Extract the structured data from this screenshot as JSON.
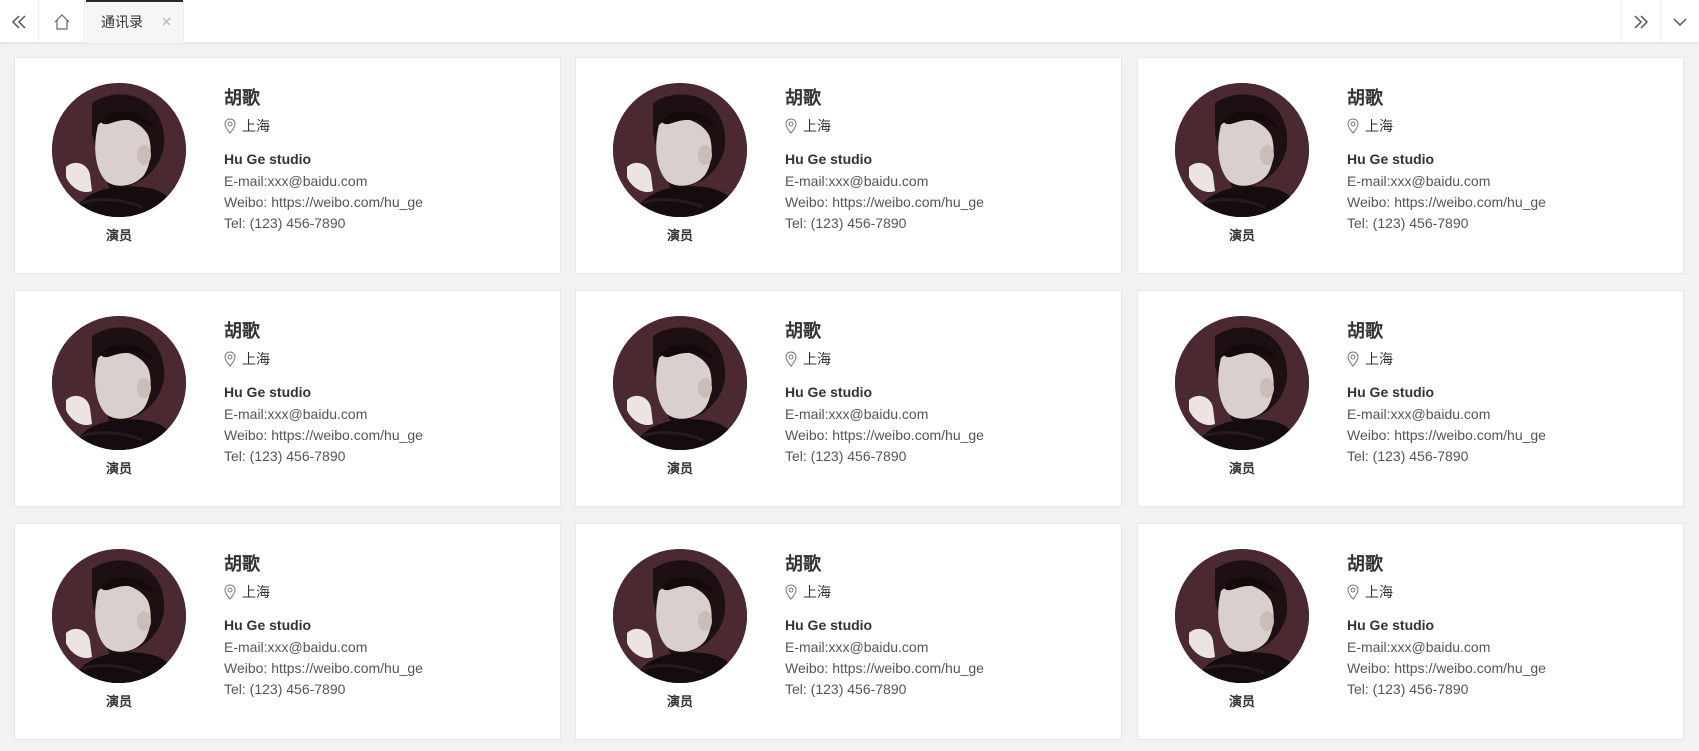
{
  "tabbar": {
    "prev_icon": "double-chevron-left-icon",
    "home_icon": "home-icon",
    "active_tab": {
      "label": "通讯录",
      "close_icon": "close-icon"
    },
    "next_icon": "double-chevron-right-icon",
    "more_icon": "chevron-down-icon"
  },
  "contacts": [
    {
      "name": "胡歌",
      "location": "上海",
      "role": "演员",
      "company": "Hu Ge studio",
      "email": "E-mail:xxx@baidu.com",
      "weibo": "Weibo: https://weibo.com/hu_ge",
      "tel": "Tel: (123) 456-7890"
    },
    {
      "name": "胡歌",
      "location": "上海",
      "role": "演员",
      "company": "Hu Ge studio",
      "email": "E-mail:xxx@baidu.com",
      "weibo": "Weibo: https://weibo.com/hu_ge",
      "tel": "Tel: (123) 456-7890"
    },
    {
      "name": "胡歌",
      "location": "上海",
      "role": "演员",
      "company": "Hu Ge studio",
      "email": "E-mail:xxx@baidu.com",
      "weibo": "Weibo: https://weibo.com/hu_ge",
      "tel": "Tel: (123) 456-7890"
    },
    {
      "name": "胡歌",
      "location": "上海",
      "role": "演员",
      "company": "Hu Ge studio",
      "email": "E-mail:xxx@baidu.com",
      "weibo": "Weibo: https://weibo.com/hu_ge",
      "tel": "Tel: (123) 456-7890"
    },
    {
      "name": "胡歌",
      "location": "上海",
      "role": "演员",
      "company": "Hu Ge studio",
      "email": "E-mail:xxx@baidu.com",
      "weibo": "Weibo: https://weibo.com/hu_ge",
      "tel": "Tel: (123) 456-7890"
    },
    {
      "name": "胡歌",
      "location": "上海",
      "role": "演员",
      "company": "Hu Ge studio",
      "email": "E-mail:xxx@baidu.com",
      "weibo": "Weibo: https://weibo.com/hu_ge",
      "tel": "Tel: (123) 456-7890"
    },
    {
      "name": "胡歌",
      "location": "上海",
      "role": "演员",
      "company": "Hu Ge studio",
      "email": "E-mail:xxx@baidu.com",
      "weibo": "Weibo: https://weibo.com/hu_ge",
      "tel": "Tel: (123) 456-7890"
    },
    {
      "name": "胡歌",
      "location": "上海",
      "role": "演员",
      "company": "Hu Ge studio",
      "email": "E-mail:xxx@baidu.com",
      "weibo": "Weibo: https://weibo.com/hu_ge",
      "tel": "Tel: (123) 456-7890"
    },
    {
      "name": "胡歌",
      "location": "上海",
      "role": "演员",
      "company": "Hu Ge studio",
      "email": "E-mail:xxx@baidu.com",
      "weibo": "Weibo: https://weibo.com/hu_ge",
      "tel": "Tel: (123) 456-7890"
    }
  ],
  "colors": {
    "page_bg": "#f2f2f2",
    "card_bg": "#ffffff",
    "active_tab_indicator": "#292929"
  }
}
